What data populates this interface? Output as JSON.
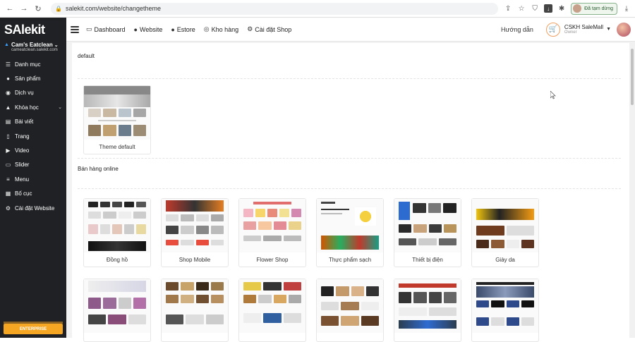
{
  "browser": {
    "url": "salekit.com/website/changetheme",
    "paused_label": "Đã tạm dừng"
  },
  "sidebar": {
    "logo": "SAlekit",
    "store_name": "Cam's Eatclean",
    "store_url": "cameatclean.salekit.com",
    "items": [
      {
        "label": "Danh mục",
        "icon": "list-icon"
      },
      {
        "label": "Sản phẩm",
        "icon": "product-icon"
      },
      {
        "label": "Dịch vụ",
        "icon": "service-icon"
      },
      {
        "label": "Khóa học",
        "icon": "course-icon",
        "has_chevron": true
      },
      {
        "label": "Bài viết",
        "icon": "article-icon"
      },
      {
        "label": "Trang",
        "icon": "page-icon"
      },
      {
        "label": "Video",
        "icon": "video-icon"
      },
      {
        "label": "Slider",
        "icon": "slider-icon"
      },
      {
        "label": "Menu",
        "icon": "menu-icon"
      },
      {
        "label": "Bố cục",
        "icon": "layout-icon"
      },
      {
        "label": "Cài đặt Website",
        "icon": "gear-icon"
      }
    ],
    "enterprise_label": "ENTERPRISE"
  },
  "topnav": {
    "items": [
      {
        "label": "Dashboard",
        "icon": "monitor-icon"
      },
      {
        "label": "Website",
        "icon": "globe-icon"
      },
      {
        "label": "Estore",
        "icon": "globe-icon"
      },
      {
        "label": "Kho hàng",
        "icon": "database-icon"
      },
      {
        "label": "Cài đặt Shop",
        "icon": "gear-icon"
      }
    ],
    "guide": "Hướng dẫn",
    "account_name": "CSKH SaleMall",
    "account_role": "Owner"
  },
  "sections": {
    "default_title": "default",
    "online_title": "Bán hàng online"
  },
  "default_themes": [
    {
      "label": "Theme default"
    }
  ],
  "online_themes_row1": [
    {
      "label": "Đồng hồ"
    },
    {
      "label": "Shop Mobile"
    },
    {
      "label": "Flower Shop"
    },
    {
      "label": "Thực phẩm sạch"
    },
    {
      "label": "Thiết bị điện"
    },
    {
      "label": "Giày da"
    }
  ],
  "colors": {
    "sidebar_bg": "#1f2124",
    "accent_orange": "#f5a623",
    "link_blue": "#3aa0ff"
  }
}
